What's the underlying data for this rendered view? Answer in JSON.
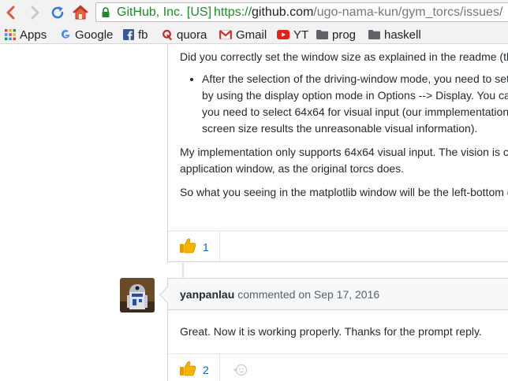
{
  "browser": {
    "ev_label": "GitHub, Inc. [US]",
    "url_scheme": "https://",
    "url_host": "github.com",
    "url_path": "/ugo-nama-kun/gym_torcs/issues/"
  },
  "bookmarks": [
    {
      "label": "Apps",
      "icon": "apps-grid-icon"
    },
    {
      "label": "Google",
      "icon": "google-icon"
    },
    {
      "label": "fb",
      "icon": "facebook-icon"
    },
    {
      "label": "quora",
      "icon": "quora-icon"
    },
    {
      "label": "Gmail",
      "icon": "gmail-icon"
    },
    {
      "label": "YT",
      "icon": "youtube-icon"
    },
    {
      "label": "prog",
      "icon": "folder-icon"
    },
    {
      "label": "haskell",
      "icon": "folder-icon"
    }
  ],
  "comment1": {
    "question": "Did you correctly set the window size as explained in the readme (th",
    "bullet_lines": [
      "After the selection of the driving-window mode, you need to set",
      "by using the display option mode in Options --> Display. You ca",
      "you need to select 64x64 for visual input (our immplementation",
      "screen size results the unreasonable visual information)."
    ],
    "para2_lines": [
      "My implementation only supports 64x64 visual input. The vision is c",
      "application window, as the original torcs does."
    ],
    "para3": "So what you seeing in the matplotlib window will be the left-bottom c",
    "reaction_count": "1"
  },
  "comment2": {
    "author": "yanpanlau",
    "action": "commented",
    "time": "on Sep 17, 2016",
    "body": "Great. Now it is working properly. Thanks for the prompt reply.",
    "reaction_count": "2"
  },
  "colors": {
    "secure_green": "#1d8a2a",
    "link_blue": "#0366d6",
    "thumbs_yellow": "#f5b400"
  }
}
